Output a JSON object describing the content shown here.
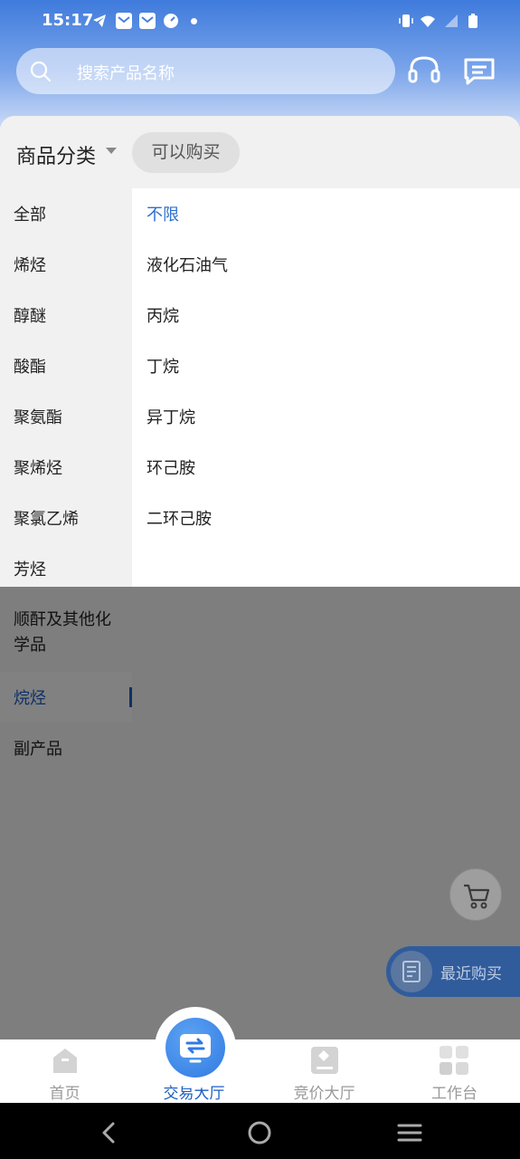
{
  "status_bar": {
    "time": "15:17",
    "icons": [
      "telegram-icon",
      "mail-icon",
      "mail-icon",
      "speedometer-icon",
      "dot-icon",
      "vibrate-icon",
      "wifi-icon",
      "signal-icon",
      "battery-icon"
    ]
  },
  "search": {
    "placeholder": "搜索产品名称"
  },
  "header_actions": [
    "headset-icon",
    "message-icon"
  ],
  "filter": {
    "category_label": "商品分类",
    "chip_label": "可以购买"
  },
  "left_categories": [
    {
      "label": "全部"
    },
    {
      "label": "烯烃"
    },
    {
      "label": "醇醚"
    },
    {
      "label": "酸酯"
    },
    {
      "label": "聚氨酯"
    },
    {
      "label": "聚烯烃"
    },
    {
      "label": "聚氯乙烯"
    },
    {
      "label": "芳烃"
    },
    {
      "label": "顺酐及其他化学品"
    },
    {
      "label": "烷烃"
    },
    {
      "label": "副产品"
    }
  ],
  "active_category_index": 9,
  "right_items": [
    {
      "label": "不限"
    },
    {
      "label": "液化石油气"
    },
    {
      "label": "丙烷"
    },
    {
      "label": "丁烷"
    },
    {
      "label": "异丁烷"
    },
    {
      "label": "环己胺"
    },
    {
      "label": "二环己胺"
    }
  ],
  "active_right_index": 0,
  "floating": {
    "recent_label": "最近购买"
  },
  "tabs": [
    {
      "label": "首页",
      "icon": "home-icon"
    },
    {
      "label": "交易大厅",
      "icon": "exchange-icon"
    },
    {
      "label": "竞价大厅",
      "icon": "gavel-icon"
    },
    {
      "label": "工作台",
      "icon": "grid-icon"
    }
  ],
  "active_tab_index": 1,
  "colors": {
    "accent": "#1d5fc2",
    "header_top": "#3f7bdc",
    "overlay": "#000000"
  }
}
